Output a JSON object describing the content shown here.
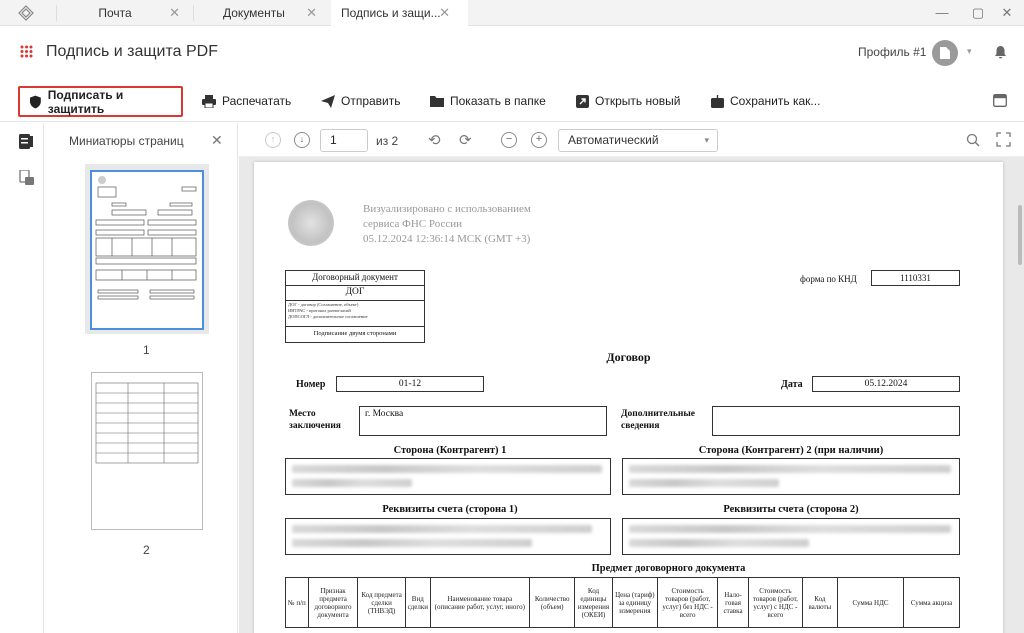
{
  "tabs": [
    {
      "label": "Почта"
    },
    {
      "label": "Документы"
    },
    {
      "label": "Подпись и защи..."
    }
  ],
  "header": {
    "title": "Подпись и защита PDF",
    "profile": "Профиль #1"
  },
  "toolbar": {
    "sign": "Подписать и защитить",
    "print": "Распечатать",
    "send": "Отправить",
    "folder": "Показать в папке",
    "open_new": "Открыть новый",
    "save_as": "Сохранить как..."
  },
  "thumbs": {
    "title": "Миниатюры страниц",
    "pages": [
      "1",
      "2"
    ]
  },
  "viewer": {
    "page": "1",
    "page_count": "из 2",
    "zoom": "Автоматический"
  },
  "doc": {
    "visualized": [
      "Визуализировано с использованием",
      "сервиса ФНС России",
      "05.12.2024 12:36:14 МСК (GMT +3)"
    ],
    "doc_type": "Договорный документ",
    "doc_code": "ДОГ",
    "doc_codes_note": [
      "ДОГ - договор (Соглашение, объект)",
      "ИНТРАС - протокол разногласий",
      "ДОПСОГЛ - дополнительное соглашение"
    ],
    "signed_by": "Подписание двумя сторонами",
    "knd_label": "форма по КНД",
    "knd": "1110331",
    "title": "Договор",
    "number_label": "Номер",
    "number": "01-12",
    "date_label": "Дата",
    "date": "05.12.2024",
    "place_label": [
      "Место",
      "заключения"
    ],
    "place": "г. Москва",
    "extra_label": [
      "Дополнительные",
      "сведения"
    ],
    "party1": "Сторона (Контрагент) 1",
    "party2": "Сторона (Контрагент) 2 (при наличии)",
    "acc1": "Реквизиты счета (сторона 1)",
    "acc2": "Реквизиты счета (сторона 2)",
    "subject": "Предмет договорного документа",
    "columns": [
      "№ п/п",
      "Признак предмета договорного документа",
      "Код предмета сделки (ТНВЭД)",
      "Вид сделки",
      "Наименование товара (описание работ, услуг, иного)",
      "Количество (объем)",
      "Код единицы измерения (ОКЕИ)",
      "Цена (тариф) за единицу измерения",
      "Стоимость товаров (работ, услуг) без НДС - всего",
      "Нало-говая ставка",
      "Стоимость товаров (работ, услуг) с НДС - всего",
      "Код валюты",
      "Сумма НДС",
      "Сумма акциза"
    ]
  }
}
